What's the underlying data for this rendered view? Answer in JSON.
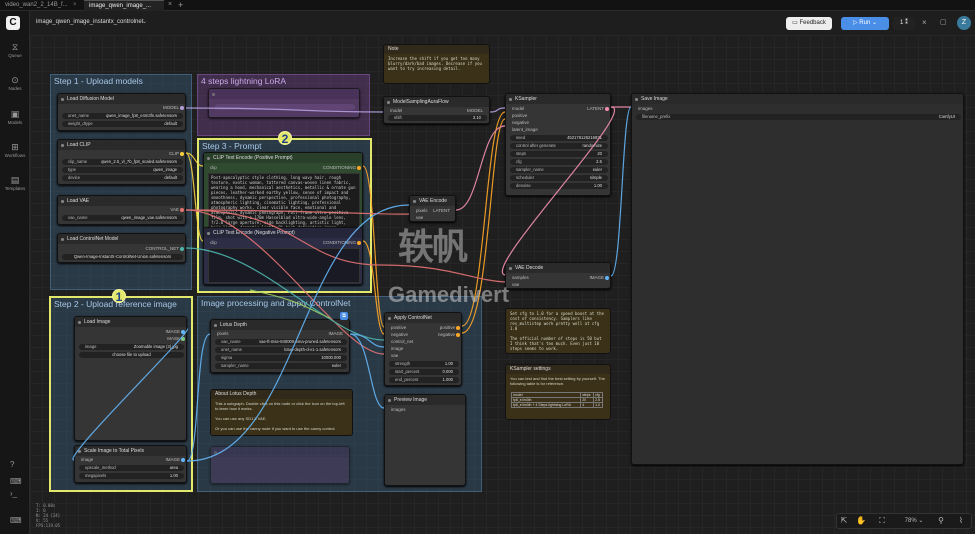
{
  "tabs": [
    "video_wan2_2_14B_f...",
    "image_qwen_image_..."
  ],
  "workflow_title": "image_qwen_image_instantx_controlnet",
  "header": {
    "feedback": "Feedback",
    "run": "Run",
    "queue_count": "1"
  },
  "avatar_letter": "Z",
  "sidebar": [
    {
      "label": "Queue",
      "icon": "queue-icon"
    },
    {
      "label": "Nodes",
      "icon": "nodes-icon"
    },
    {
      "label": "Models",
      "icon": "models-icon"
    },
    {
      "label": "Workflows",
      "icon": "workflows-icon"
    },
    {
      "label": "Templates",
      "icon": "templates-icon"
    }
  ],
  "groups": {
    "step1": "Step 1 - Upload models",
    "lora": "4 steps lightning LoRA",
    "step3": "Step 3 - Prompt",
    "step2": "Step 2 - Upload reference image",
    "imgproc": "Image processing and apply ControlNet"
  },
  "nodes": {
    "load_diffusion": {
      "title": "Load Diffusion Model",
      "out": "MODEL",
      "unet_name_k": "unet_name",
      "unet_name_v": "qwen_image_fp8_e4m3fn.safetensors",
      "weight_dtype_k": "weight_dtype",
      "weight_dtype_v": "default"
    },
    "load_clip": {
      "title": "Load CLIP",
      "out": "CLIP",
      "clip_name_k": "clip_name",
      "clip_name_v": "qwen_2.5_vl_7b_fp8_scaled.safetensors",
      "type_k": "type",
      "type_v": "qwen_image",
      "device_k": "device",
      "device_v": "default"
    },
    "load_vae": {
      "title": "Load VAE",
      "out": "VAE",
      "vae_name_k": "vae_name",
      "vae_name_v": "qwen_image_vae.safetensors"
    },
    "load_controlnet": {
      "title": "Load ControlNet Model",
      "out": "CONTROL_NET",
      "cn_v": "Qwen-Image-InstantX-ControlNet-Union.safetensors"
    },
    "model_sampling": {
      "title": "ModelSamplingAuraFlow",
      "in": "model",
      "out": "MODEL",
      "shift_k": "shift",
      "shift_v": "3.10"
    },
    "ksampler": {
      "title": "KSampler",
      "in": [
        "model",
        "positive",
        "negative",
        "latent_image"
      ],
      "out": "LATENT",
      "seed_k": "seed",
      "seed_v": "452176126216831",
      "cag_k": "control after generate",
      "cag_v": "randomize",
      "steps_k": "steps",
      "steps_v": "20",
      "cfg_k": "cfg",
      "cfg_v": "2.5",
      "sampler_k": "sampler_name",
      "sampler_v": "euler",
      "scheduler_k": "scheduler",
      "scheduler_v": "simple",
      "denoise_k": "denoise",
      "denoise_v": "1.00"
    },
    "save_image": {
      "title": "Save Image",
      "in": "images",
      "prefix_k": "filename_prefix",
      "prefix_v": "ComfyUI"
    },
    "clip_pos": {
      "title": "CLIP Text Encode (Positive Prompt)",
      "in": "clip",
      "out": "CONDITIONING",
      "text": "Post-apocalyptic style clothing, long wavy hair, rough texture, exotic woman, tattered canvas-woven linen fabric, wearing a hood, mechanical aesthetics, metallic & ornate gun pieces, leather-worked earthy yellow, sense of impact and smoothness, dynamic perspective, professional photography, atmospheric lighting, cinematic lighting, professional photography works, clear visible face, emotional and atmospheric dynamic photograph, Full-frame ultra-positive film, shot with a 170m Hasselblad ultra-wide-angle lens, f/2.8 large aperture, side backlighting, artistic light, hair light, dramatic light, 8k high-definition image quality, delicate real human skin texture"
    },
    "clip_neg": {
      "title": "CLIP Text Encode (Negative Prompt)",
      "in": "clip",
      "out": "CONDITIONING"
    },
    "vae_encode": {
      "title": "VAE Encode",
      "in": [
        "pixels",
        "vae"
      ],
      "out": "LATENT"
    },
    "vae_decode": {
      "title": "VAE Decode",
      "in": [
        "samples",
        "vae"
      ],
      "out": "IMAGE"
    },
    "load_image": {
      "title": "Load Image",
      "out": [
        "IMAGE",
        "MASK"
      ],
      "image_k": "image",
      "image_v": "Zoomable image (3).jpg",
      "upload": "choose file to upload"
    },
    "scale_image": {
      "title": "Scale Image to Total Pixels",
      "in": "image",
      "out": "IMAGE",
      "method_k": "upscale_method",
      "method_v": "area",
      "mp_k": "megapixels",
      "mp_v": "1.00"
    },
    "lotus_depth": {
      "title": "Lotus Depth",
      "in": "pixels",
      "out": "IMAGE",
      "vae_k": "vae_name",
      "vae_v": "vae-ft-mse-840000-ema-pruned.safetensors",
      "unet_k": "unet_name",
      "unet_v": "lotus-depth-d-v1-1.safetensors",
      "sigma_k": "sigma",
      "sigma_v": "10000.000",
      "sampler_k": "sampler_name",
      "sampler_v": "euler"
    },
    "about_lotus": {
      "title": "About Lotus Depth",
      "text": "This a subgraph. Double click on this node or click the icon on the top-left to learn how it works.\n\nYou can use any SD1.5 VAE.\n\nOr you can use the canny node if you want to use the canny control."
    },
    "apply_controlnet": {
      "title": "Apply ControlNet",
      "in": [
        "positive",
        "negative",
        "control_net",
        "image",
        "vae"
      ],
      "out": [
        "positive",
        "negative"
      ],
      "strength_k": "strength",
      "strength_v": "1.00",
      "start_k": "start_percent",
      "start_v": "0.000",
      "end_k": "end_percent",
      "end_v": "1.000"
    },
    "preview_image": {
      "title": "Preview Image",
      "in": "images"
    },
    "note1": {
      "title": "Note",
      "text": "Increase the shift if you get too many blurry/dark/bad images. Decrease if you want to try increasing detail."
    },
    "note2": {
      "text": "Set cfg to 1.0 for a speed boost at the cost of consistency. Samplers like res_multistep work pretty well at cfg 1.0\n\nThe official number of steps is 50 but I think that's too much. Even just 10 steps seems to work."
    },
    "ks_settings": {
      "title": "KSampler settings",
      "desc": "You can test and find the best setting by yourself. The following table is for reference.",
      "table": {
        "head": [
          "model",
          "steps",
          "cfg"
        ],
        "rows": [
          [
            "fp8_e4m3fn",
            "20",
            "2.5"
          ],
          [
            "fp8_e4m3fn + 4 Steps lightning LoRA",
            "4",
            "1.0"
          ]
        ]
      }
    }
  },
  "badges": [
    "1",
    "2"
  ],
  "watermark": {
    "cn": "轶帆",
    "en": "Gamedivert"
  },
  "stats": [
    "T: 0.00s",
    "I: 0",
    "N: 24 [24]",
    "V: 55",
    "FPS:119.05"
  ],
  "bottom": {
    "zoom": "78%"
  }
}
